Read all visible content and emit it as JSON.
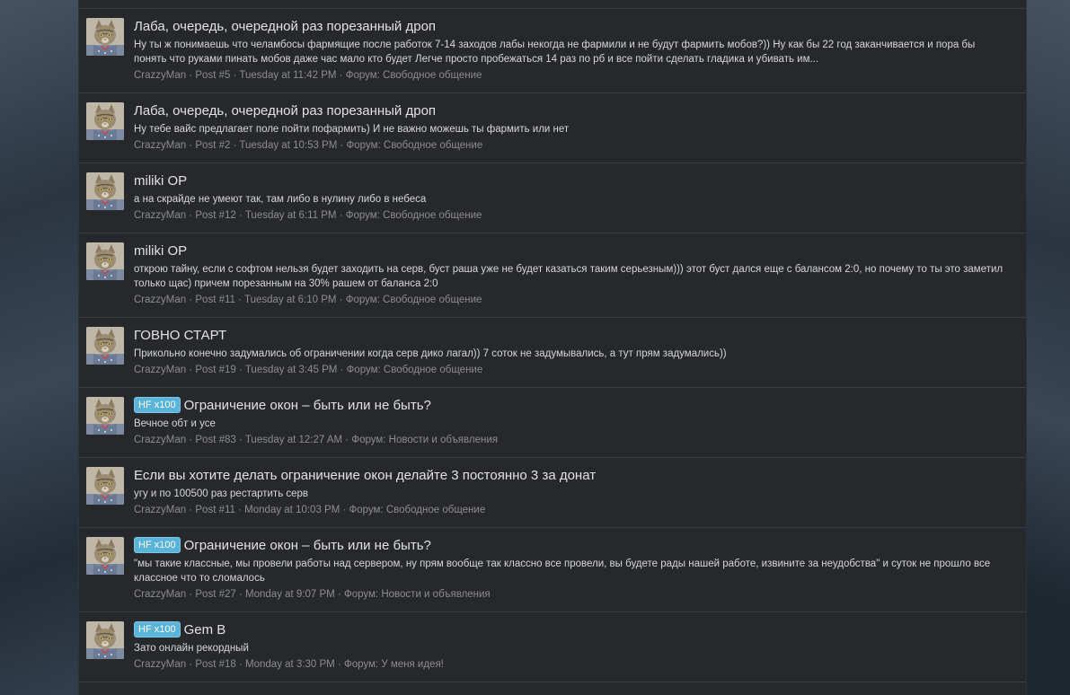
{
  "results": [
    {
      "prefix": "",
      "title": "Лаба, очередь, очередной раз порезанный дроп",
      "snippet": "Ну ты ж понимаешь что челамбосы фармящие после работок 7-14 заходов лабы некогда не фармили и не будут фармить мобов?)) Ну как бы 22 год заканчивается и пора бы понять что руками пинать мобов даже час мало кто будет Легче просто пробежаться 14 раз по рб и все пойти сделать гладика и убивать им...",
      "author": "CrazzyMan",
      "post": "Post #5",
      "date": "Tuesday at 11:42 PM",
      "forum_label": "Форум:",
      "forum": "Свободное общение"
    },
    {
      "prefix": "",
      "title": "Лаба, очередь, очередной раз порезанный дроп",
      "snippet": "Ну тебе вайс предлагает поле пойти пофармить) И не важно можешь ты фармить или нет",
      "author": "CrazzyMan",
      "post": "Post #2",
      "date": "Tuesday at 10:53 PM",
      "forum_label": "Форум:",
      "forum": "Свободное общение"
    },
    {
      "prefix": "",
      "title": "miliki OP",
      "snippet": "а на скрайде не умеют так, там либо в нулину либо в небеса",
      "author": "CrazzyMan",
      "post": "Post #12",
      "date": "Tuesday at 6:11 PM",
      "forum_label": "Форум:",
      "forum": "Свободное общение"
    },
    {
      "prefix": "",
      "title": "miliki OP",
      "snippet": "открою тайну, если с софтом нельзя будет заходить на серв, буст раша уже не будет казаться таким серьезным))) этот буст дался еще с балансом 2:0, но почему то ты это заметил только щас) причем порезанным на 30% рашем от баланса 2:0",
      "author": "CrazzyMan",
      "post": "Post #11",
      "date": "Tuesday at 6:10 PM",
      "forum_label": "Форум:",
      "forum": "Свободное общение"
    },
    {
      "prefix": "",
      "title": "ГОВНО СТАРТ",
      "snippet": "Прикольно конечно задумались об ограничении когда серв дико лагал)) 7 соток не задумывались, а тут прям задумались))",
      "author": "CrazzyMan",
      "post": "Post #19",
      "date": "Tuesday at 3:45 PM",
      "forum_label": "Форум:",
      "forum": "Свободное общение"
    },
    {
      "prefix": "HF x100",
      "title": "Ограничение окон – быть или не быть?",
      "snippet": "Вечное обт и усе",
      "author": "CrazzyMan",
      "post": "Post #83",
      "date": "Tuesday at 12:27 AM",
      "forum_label": "Форум:",
      "forum": "Новости и объявления"
    },
    {
      "prefix": "",
      "title": "Если вы хотите делать ограничение окон делайте 3 постоянно 3 за донат",
      "snippet": "угу и по 100500 раз рестартить серв",
      "author": "CrazzyMan",
      "post": "Post #11",
      "date": "Monday at 10:03 PM",
      "forum_label": "Форум:",
      "forum": "Свободное общение"
    },
    {
      "prefix": "HF x100",
      "title": "Ограничение окон – быть или не быть?",
      "snippet": "\"мы такие классные, мы провели работы над сервером, ну прям вообще так классно все провели, вы будете рады нашей работе, извините за неудобства\" и суток не прошло все классное что то сломалось",
      "author": "CrazzyMan",
      "post": "Post #27",
      "date": "Monday at 9:07 PM",
      "forum_label": "Форум:",
      "forum": "Новости и объявления"
    },
    {
      "prefix": "HF x100",
      "title": "Gem B",
      "snippet": "Зато онлайн рекордный",
      "author": "CrazzyMan",
      "post": "Post #18",
      "date": "Monday at 3:30 PM",
      "forum_label": "Форум:",
      "forum": "У меня идея!"
    }
  ]
}
